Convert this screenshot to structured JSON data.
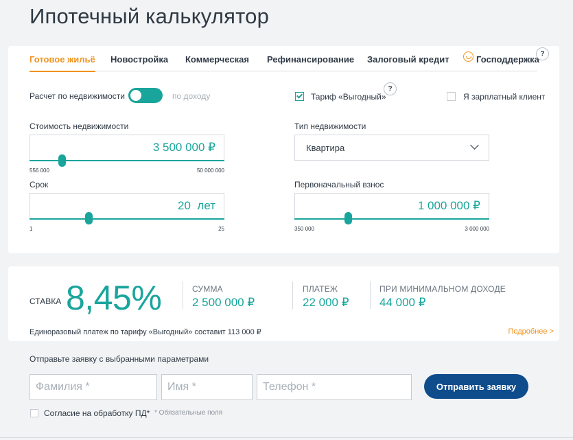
{
  "page": {
    "title": "Ипотечный калькулятор"
  },
  "tabs": [
    {
      "label": "Готовое жильё",
      "active": true
    },
    {
      "label": "Новостройка",
      "active": false
    },
    {
      "label": "Коммерческая",
      "active": false
    },
    {
      "label": "Рефинансирование",
      "active": false
    },
    {
      "label": "Залоговый кредит",
      "active": false
    },
    {
      "label": "Господдержка",
      "active": false,
      "icon": "smile-icon"
    }
  ],
  "help_icon": "?",
  "calc_mode": {
    "left_label": "Расчет по недвижимости",
    "right_label": "по доходу",
    "state": "by-property"
  },
  "tariff": {
    "label": "Тариф «Выгодный»",
    "checked": true
  },
  "salary_client": {
    "label": "Я зарплатный клиент",
    "checked": false
  },
  "property_cost": {
    "label": "Стоимость недвижимости",
    "value": "3 500 000 ₽",
    "min_label": "556 000",
    "max_label": "50 000 000",
    "min": 556000,
    "max": 50000000,
    "current": 3500000
  },
  "property_type": {
    "label": "Тип недвижимости",
    "value": "Квартира"
  },
  "term": {
    "label": "Срок",
    "value": "20  лет",
    "min_label": "1",
    "max_label": "25",
    "min": 1,
    "max": 25,
    "current": 20
  },
  "down_payment": {
    "label": "Первоначальный взнос",
    "value": "1 000 000 ₽",
    "min_label": "350 000",
    "max_label": "3 000 000",
    "min": 350000,
    "max": 3000000,
    "current": 1000000
  },
  "result": {
    "rate_label": "СТАВКА",
    "rate_value": "8,45%",
    "sum_label": "СУММА",
    "sum_value": "2 500 000 ₽",
    "payment_label": "ПЛАТЕЖ",
    "payment_value": "22 000 ₽",
    "min_income_label": "ПРИ МИНИМАЛЬНОМ ДОХОДЕ",
    "min_income_value": "44 000 ₽",
    "note": "Единоразовый платеж по тарифу «Выгодный» составит 113 000 ₽",
    "more_link": "Подробнее >"
  },
  "application": {
    "title": "Отправьте заявку с выбранными параметрами",
    "surname_placeholder": "Фамилия *",
    "name_placeholder": "Имя *",
    "phone_placeholder": "Телефон *",
    "submit_label": "Отправить заявку",
    "consent_label": "Согласие на обработку ПД*",
    "required_note": "* Обязательные поля"
  },
  "colors": {
    "accent": "#19a59c",
    "orange": "#f0931e",
    "primary_button": "#0e4c8c",
    "text": "#303a45"
  }
}
